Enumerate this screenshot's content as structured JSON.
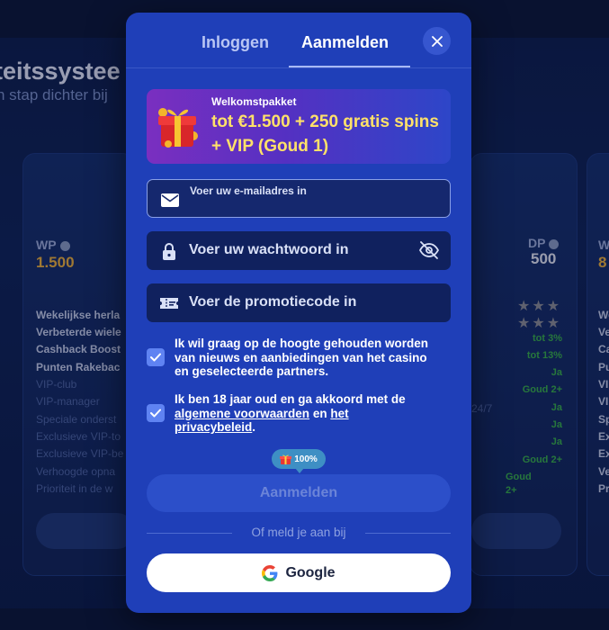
{
  "background": {
    "title": "teitssystee",
    "subtitle": "n stap dichter bij",
    "left_card": {
      "label": "WP",
      "value": "1.500",
      "features_strong": [
        "Wekelijkse herla",
        "Verbeterde wiele",
        "Cashback Boost",
        "Punten Rakebac"
      ],
      "features_dim": [
        "VIP-club",
        "VIP-manager",
        "Speciale onderst",
        "Exclusieve VIP-to",
        "Exclusieve VIP-be",
        "Verhoogde opna",
        "Prioriteit in de w"
      ]
    },
    "right_card": {
      "label": "DP",
      "value": "500",
      "stars_row1": "★★★",
      "stars_row2": "★★★",
      "values": [
        "tot 3%",
        "tot 13%",
        "Ja",
        "Goud 2+",
        "Ja",
        "Ja",
        "Ja",
        "Goud 2+",
        "Goud",
        "2+"
      ],
      "side_text": "24/7"
    },
    "far_card": {
      "label": "W",
      "value": "8",
      "features": [
        "We",
        "Ve",
        "Ca",
        "Pu",
        "VI",
        "VI",
        "Sp",
        "Ex",
        "Ex",
        "Ve",
        "Pr"
      ]
    }
  },
  "modal": {
    "tabs": {
      "login": "Inloggen",
      "register": "Aanmelden"
    },
    "close_label": "×",
    "banner": {
      "label": "Welkomstpakket",
      "offer": "tot €1.500 + 250 gratis spins + VIP (Goud 1)"
    },
    "email": {
      "placeholder": "Voer uw e-mailadres in",
      "value": ""
    },
    "password": {
      "placeholder": "Voer uw wachtwoord in"
    },
    "promo": {
      "placeholder": "Voer de promotiecode in"
    },
    "consent_marketing": "Ik wil graag op de hoogte gehouden worden van nieuws en aanbiedingen van het casino en geselecteerde partners.",
    "consent_terms": {
      "prefix": "Ik ben 18 jaar oud en ga akkoord met de ",
      "terms_link": "algemene voorwaarden",
      "middle": " en ",
      "privacy_link": "het privacybeleid",
      "suffix": "."
    },
    "bonus_badge": "100%",
    "submit_label": "Aanmelden",
    "divider_text": "Of meld je aan bij",
    "google_label": "Google",
    "colors": {
      "modal": "#1f3fb8",
      "accent_gold": "#ffe169",
      "checkbox": "#5f83f2"
    }
  }
}
